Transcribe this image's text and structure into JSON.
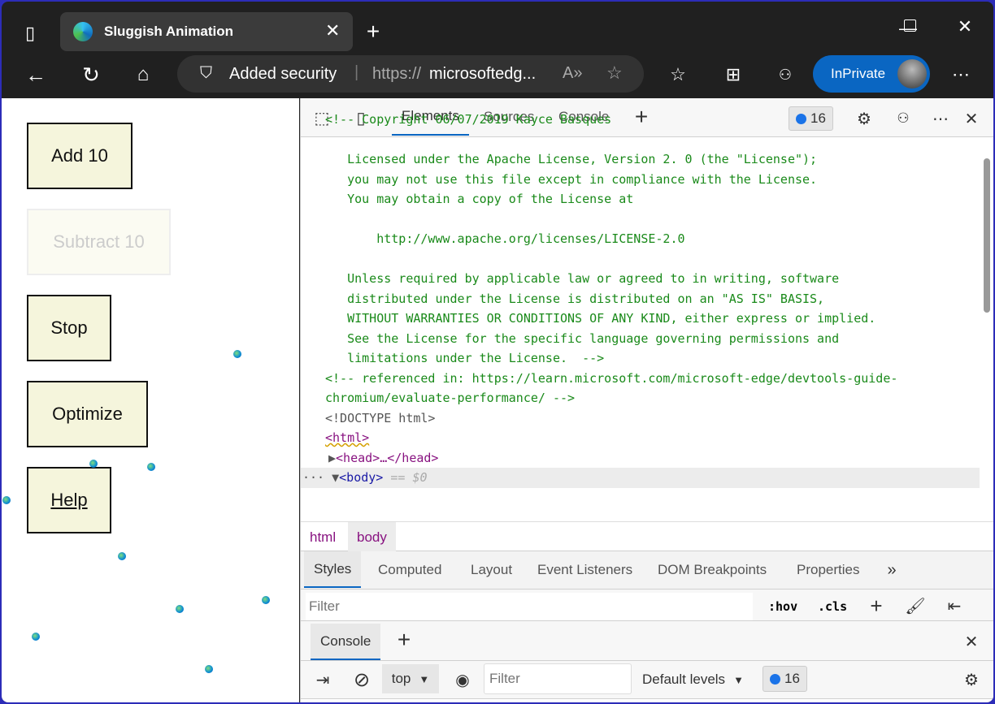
{
  "browser": {
    "tab_title": "Sluggish Animation",
    "address_security": "Added security",
    "url_prefix": "https://",
    "url_host": "microsoftedg...",
    "inprivate": "InPrivate"
  },
  "page": {
    "buttons": [
      {
        "label": "Add 10"
      },
      {
        "label": "Subtract 10",
        "disabled": true
      },
      {
        "label": "Stop"
      },
      {
        "label": "Optimize"
      },
      {
        "label": "Help",
        "link": true
      }
    ]
  },
  "devtools": {
    "tabs": [
      "Elements",
      "Sources",
      "Console"
    ],
    "issues_count": "16",
    "code_lines": [
      "<!-- Copyright 06/07/2019 Kayce Basques",
      "",
      "   Licensed under the Apache License, Version 2. 0 (the \"License\");",
      "   you may not use this file except in compliance with the License.",
      "   You may obtain a copy of the License at",
      "",
      "       http://www.apache.org/licenses/LICENSE-2.0",
      "",
      "   Unless required by applicable law or agreed to in writing, software",
      "   distributed under the License is distributed on an \"AS IS\" BASIS,",
      "   WITHOUT WARRANTIES OR CONDITIONS OF ANY KIND, either express or implied.",
      "   See the License for the specific language governing permissions and",
      "   limitations under the License.  -->",
      "<!-- referenced in: https://learn.microsoft.com/microsoft-edge/devtools-guide-",
      "chromium/evaluate-performance/ -->"
    ],
    "doctype": "<!DOCTYPE html>",
    "html_tag": "<html>",
    "head_tag": "<head>…</head>",
    "body_tag": "<body>",
    "body_suffix": "== $0",
    "breadcrumbs": [
      "html",
      "body"
    ],
    "style_tabs": [
      "Styles",
      "Computed",
      "Layout",
      "Event Listeners",
      "DOM Breakpoints",
      "Properties"
    ],
    "styles_filter_placeholder": "Filter",
    "hov": ":hov",
    "cls": ".cls",
    "drawer_tab": "Console",
    "console_context": "top",
    "console_filter_placeholder": "Filter",
    "levels": "Default levels",
    "console_issues": "16"
  }
}
